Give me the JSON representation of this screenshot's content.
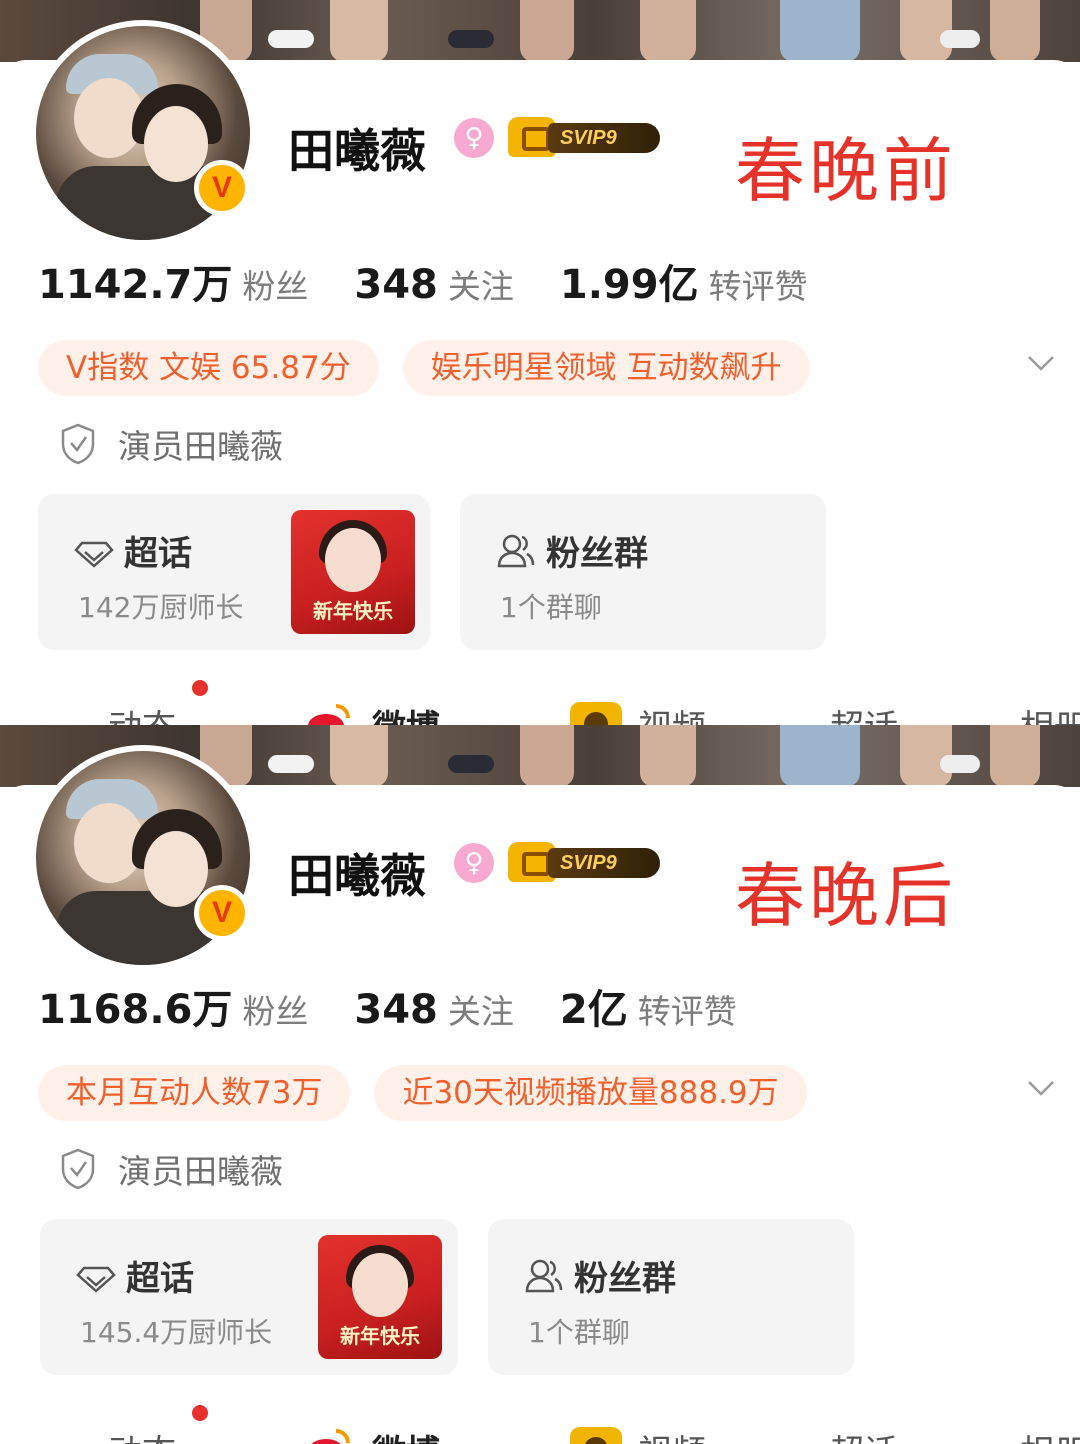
{
  "panels": [
    {
      "annotation": "春晚前",
      "profile": {
        "name": "田曦薇",
        "vip_label": "SVIP9"
      },
      "stats": [
        {
          "value": "1142.7万",
          "label": "粉丝"
        },
        {
          "value": "348",
          "label": "关注"
        },
        {
          "value": "1.99亿",
          "label": "转评赞"
        }
      ],
      "chips": [
        "V指数 文娱 65.87分",
        "娱乐明星领域 互动数飙升"
      ],
      "identity": "演员田曦薇",
      "supertopic": {
        "title": "超话",
        "subtitle": "142万厨师长",
        "thumb_caption": "新年快乐"
      },
      "fangroup": {
        "title": "粉丝群",
        "subtitle": "1个群聊"
      },
      "tabs": [
        "动态",
        "微博",
        "视频",
        "超话",
        "相册"
      ]
    },
    {
      "annotation": "春晚后",
      "profile": {
        "name": "田曦薇",
        "vip_label": "SVIP9"
      },
      "stats": [
        {
          "value": "1168.6万",
          "label": "粉丝"
        },
        {
          "value": "348",
          "label": "关注"
        },
        {
          "value": "2亿",
          "label": "转评赞"
        }
      ],
      "chips": [
        "本月互动人数73万",
        "近30天视频播放量888.9万"
      ],
      "identity": "演员田曦薇",
      "supertopic": {
        "title": "超话",
        "subtitle": "145.4万厨师长",
        "thumb_caption": "新年快乐"
      },
      "fangroup": {
        "title": "粉丝群",
        "subtitle": "1个群聊"
      },
      "tabs": [
        "动态",
        "微博",
        "视频",
        "超话",
        "相册"
      ]
    }
  ],
  "colors": {
    "accent_orange": "#f0612e",
    "chip_bg": "#fff1ea",
    "annotation_red": "#e5332a",
    "badge_gold": "#ffb400",
    "notification_red": "#e8302c"
  },
  "icons": {
    "verified": "verified-v-icon",
    "gender": "female-icon",
    "vip": "svip-crown-icon",
    "identity": "shield-check-icon",
    "supertopic": "diamond-icon",
    "fangroup": "group-users-icon",
    "expand": "chevron-down-icon"
  }
}
